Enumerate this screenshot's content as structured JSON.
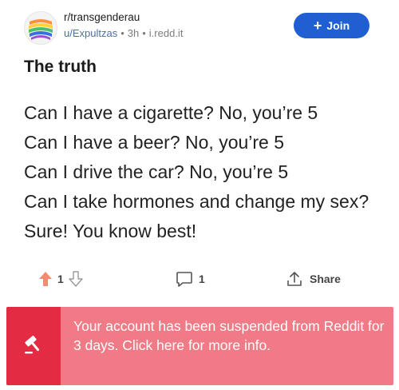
{
  "post": {
    "subreddit": "r/transgenderau",
    "author": "u/Expultzas",
    "age": "3h",
    "domain": "i.redd.it",
    "join_label": "Join",
    "title": "The truth",
    "body_lines": [
      "Can I have a cigarette? No, you’re 5",
      "Can I have a beer? No, you’re 5",
      "Can I drive the car? No, you’re 5",
      "Can I take hormones and change my sex? Sure! You know best!"
    ]
  },
  "actions": {
    "vote_count": "1",
    "comment_count": "1",
    "share_label": "Share"
  },
  "icons": {
    "avatar": "subreddit-avatar-icon",
    "upvote": "upvote-arrow-icon",
    "downvote": "downvote-arrow-icon",
    "comment": "comment-bubble-icon",
    "share": "share-icon",
    "gavel": "gavel-icon"
  },
  "banner": {
    "message": "Your account has been suspended from Reddit for 3 days. Click here for more info."
  },
  "colors": {
    "join_button": "#1f5fd1",
    "upvote_active": "#f38b6e",
    "banner_bg": "#f07a86",
    "banner_side": "#e32c44"
  }
}
